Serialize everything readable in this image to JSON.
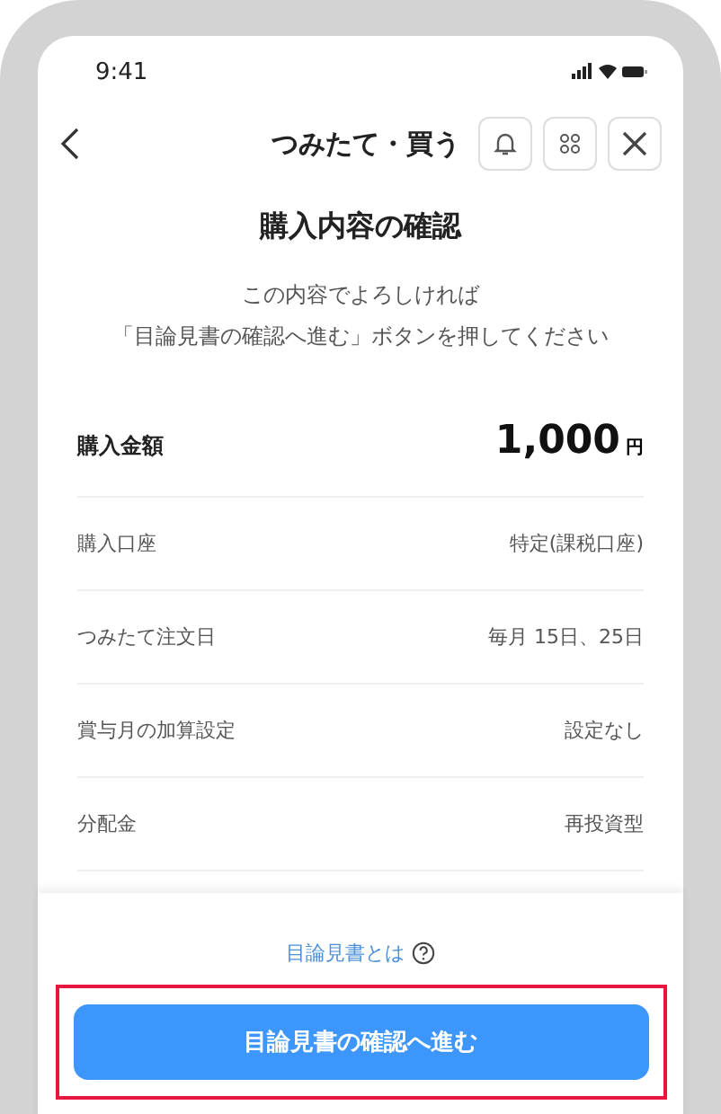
{
  "status_bar": {
    "time": "9:41"
  },
  "header": {
    "title": "つみたて・買う"
  },
  "heading": "購入内容の確認",
  "intro": [
    "この内容でよろしければ",
    "「目論見書の確認へ進む」ボタンを押してください"
  ],
  "amount": {
    "label": "購入金額",
    "value": "1,000",
    "unit": "円"
  },
  "rows": [
    {
      "label": "購入口座",
      "value": "特定(課税口座)"
    },
    {
      "label": "つみたて注文日",
      "value": "毎月 15日、25日"
    },
    {
      "label": "賞与月の加算設定",
      "value": "設定なし"
    },
    {
      "label": "分配金",
      "value": "再投資型"
    }
  ],
  "footer": {
    "link": "目論見書とは",
    "button": "目論見書の確認へ進む"
  }
}
